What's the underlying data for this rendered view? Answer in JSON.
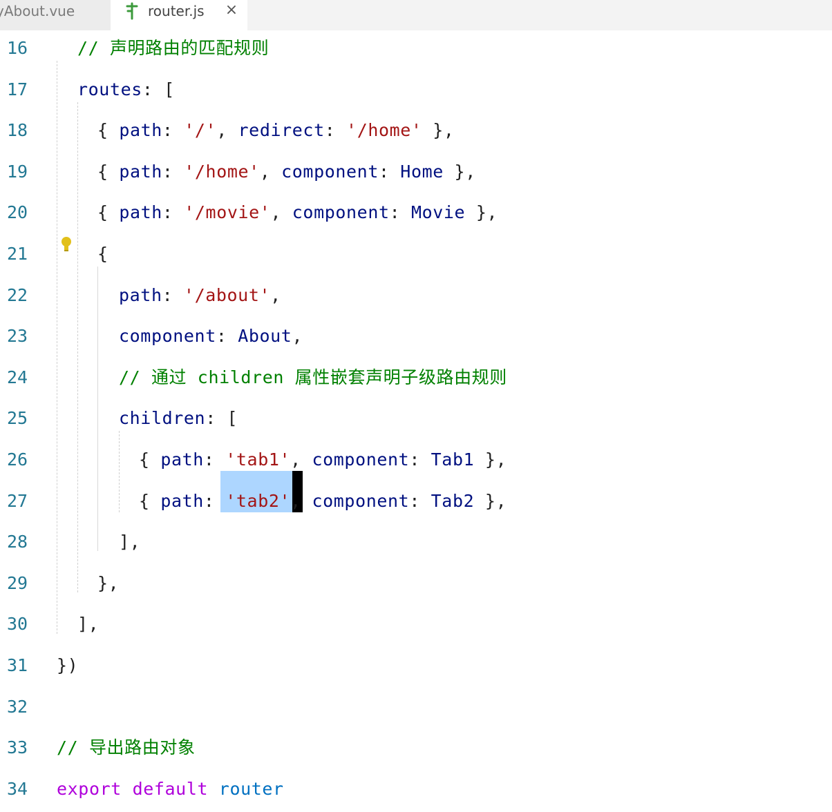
{
  "tabs": [
    {
      "label": "MyAbout.vue",
      "visible_label": "yAbout.vue",
      "active": false
    },
    {
      "label": "router.js",
      "active": true
    }
  ],
  "icons": {
    "file_icon": "route-file-icon",
    "close_icon": "close-icon",
    "bulb_icon": "lightbulb-icon"
  },
  "colors": {
    "comment": "#008000",
    "property": "#001080",
    "string": "#a31515",
    "keyword": "#af00db",
    "selection": "#add6ff"
  },
  "close_glyph": "×",
  "lines": [
    {
      "n": "16",
      "tokens": [
        [
          "c",
          "// 声明路由的匹配规则"
        ]
      ]
    },
    {
      "n": "17",
      "tokens": [
        [
          "p",
          "routes"
        ],
        [
          "u",
          ": ["
        ]
      ]
    },
    {
      "n": "18",
      "tokens": [
        [
          "u",
          "{ "
        ],
        [
          "p",
          "path"
        ],
        [
          "u",
          ": "
        ],
        [
          "s",
          "'/'"
        ],
        [
          "u",
          ", "
        ],
        [
          "p",
          "redirect"
        ],
        [
          "u",
          ": "
        ],
        [
          "s",
          "'/home'"
        ],
        [
          "u",
          " },"
        ]
      ]
    },
    {
      "n": "19",
      "tokens": [
        [
          "u",
          "{ "
        ],
        [
          "p",
          "path"
        ],
        [
          "u",
          ": "
        ],
        [
          "s",
          "'/home'"
        ],
        [
          "u",
          ", "
        ],
        [
          "p",
          "component"
        ],
        [
          "u",
          ": "
        ],
        [
          "i",
          "Home"
        ],
        [
          "u",
          " },"
        ]
      ]
    },
    {
      "n": "20",
      "tokens": [
        [
          "u",
          "{ "
        ],
        [
          "p",
          "path"
        ],
        [
          "u",
          ": "
        ],
        [
          "s",
          "'/movie'"
        ],
        [
          "u",
          ", "
        ],
        [
          "p",
          "component"
        ],
        [
          "u",
          ": "
        ],
        [
          "i",
          "Movie"
        ],
        [
          "u",
          " },"
        ]
      ]
    },
    {
      "n": "21",
      "tokens": [
        [
          "u",
          "{"
        ]
      ]
    },
    {
      "n": "22",
      "tokens": [
        [
          "p",
          "path"
        ],
        [
          "u",
          ": "
        ],
        [
          "s",
          "'/about'"
        ],
        [
          "u",
          ","
        ]
      ]
    },
    {
      "n": "23",
      "tokens": [
        [
          "p",
          "component"
        ],
        [
          "u",
          ": "
        ],
        [
          "i",
          "About"
        ],
        [
          "u",
          ","
        ]
      ]
    },
    {
      "n": "24",
      "tokens": [
        [
          "c",
          "// 通过 children 属性嵌套声明子级路由规则"
        ]
      ]
    },
    {
      "n": "25",
      "tokens": [
        [
          "p",
          "children"
        ],
        [
          "u",
          ": ["
        ]
      ]
    },
    {
      "n": "26",
      "tokens": [
        [
          "u",
          "{ "
        ],
        [
          "p",
          "path"
        ],
        [
          "u",
          ": "
        ],
        [
          "s",
          "'tab1'"
        ],
        [
          "u",
          ", "
        ],
        [
          "p",
          "component"
        ],
        [
          "u",
          ": "
        ],
        [
          "i",
          "Tab1"
        ],
        [
          "u",
          " },"
        ]
      ]
    },
    {
      "n": "27",
      "tokens": [
        [
          "u",
          "{ "
        ],
        [
          "p",
          "path"
        ],
        [
          "u",
          ": "
        ],
        [
          "s",
          "'tab2'"
        ],
        [
          "u",
          ", "
        ],
        [
          "p",
          "component"
        ],
        [
          "u",
          ": "
        ],
        [
          "i",
          "Tab2"
        ],
        [
          "u",
          " },"
        ]
      ]
    },
    {
      "n": "28",
      "tokens": [
        [
          "u",
          "],"
        ]
      ]
    },
    {
      "n": "29",
      "tokens": [
        [
          "u",
          "},"
        ]
      ]
    },
    {
      "n": "30",
      "tokens": [
        [
          "u",
          "],"
        ]
      ]
    },
    {
      "n": "31",
      "tokens": [
        [
          "u",
          "})"
        ]
      ]
    },
    {
      "n": "32",
      "tokens": []
    },
    {
      "n": "33",
      "tokens": [
        [
          "c",
          "// 导出路由对象"
        ]
      ]
    },
    {
      "n": "34",
      "tokens": [
        [
          "k",
          "export"
        ],
        [
          "u",
          " "
        ],
        [
          "k",
          "default"
        ],
        [
          "u",
          " "
        ],
        [
          "v",
          "router"
        ]
      ]
    }
  ]
}
